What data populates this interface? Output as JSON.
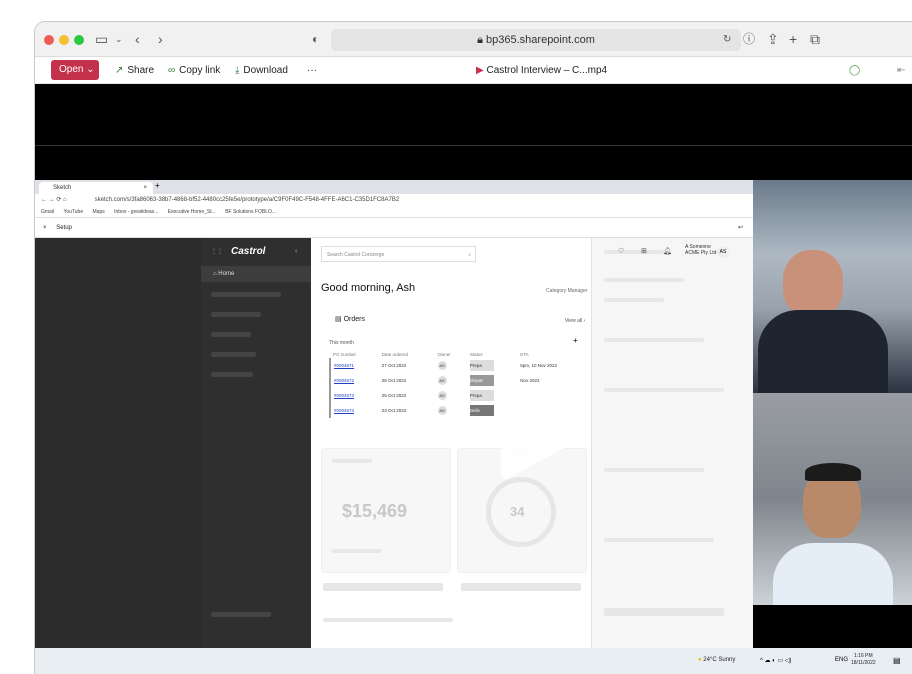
{
  "window": {
    "url": "bp365.sharepoint.com"
  },
  "toolbar": {
    "open_label": "Open",
    "share_label": "Share",
    "copy_link_label": "Copy link",
    "download_label": "Download",
    "more_label": "···",
    "file_name": "Castrol Interview – C...mp4"
  },
  "shared_screen": {
    "browser_tab": "Sketch",
    "address": "sketch.com/s/3fa86063-38b7-4868-bf52-4480cc25fe5e/prototype/a/C9F0F49C-F548-4FFE-A6C1-C35D1FC8A7B2",
    "bookmarks": [
      "Gmail",
      "YouTube",
      "Maps",
      "Inbox - greatideas...",
      "Executive Home_St...",
      "BF Solutions FOBLO..."
    ],
    "setup_label": "Setup",
    "app": {
      "logo": "Castrol",
      "nav_home": "Home",
      "search_placeholder": "Search Castrol Concierge",
      "user_name": "A Someone",
      "user_company": "ACME Pty Ltd",
      "user_initials": "AS",
      "greeting": "Good morning, Ash",
      "role": "Category Manager",
      "orders_title": "Orders",
      "view_all": "View all",
      "this_month": "This month",
      "columns": [
        "PO number",
        "Date ordered",
        "Owner",
        "Status",
        "ETA"
      ],
      "orders": [
        {
          "po": "#0004571",
          "date": "27 Oct 2022",
          "owner": "AS",
          "status": "Prepa",
          "eta": "5pm, 10 Nov 2022"
        },
        {
          "po": "#0004572",
          "date": "25 Oct 2022",
          "owner": "AS",
          "status": "Dispat",
          "eta": "Nov 2022"
        },
        {
          "po": "#0004573",
          "date": "25 Oct 2022",
          "owner": "AS",
          "status": "Prepa",
          "eta": ""
        },
        {
          "po": "#0004574",
          "date": "23 Oct 2022",
          "owner": "AS",
          "status": "Deliv",
          "eta": ""
        }
      ],
      "big_value": "$15,469",
      "gauge_value": "34"
    },
    "taskbar": {
      "weather": "24°C  Sunny",
      "time": "1:16 PM",
      "date": "18/11/2022",
      "lang": "ENG"
    }
  }
}
